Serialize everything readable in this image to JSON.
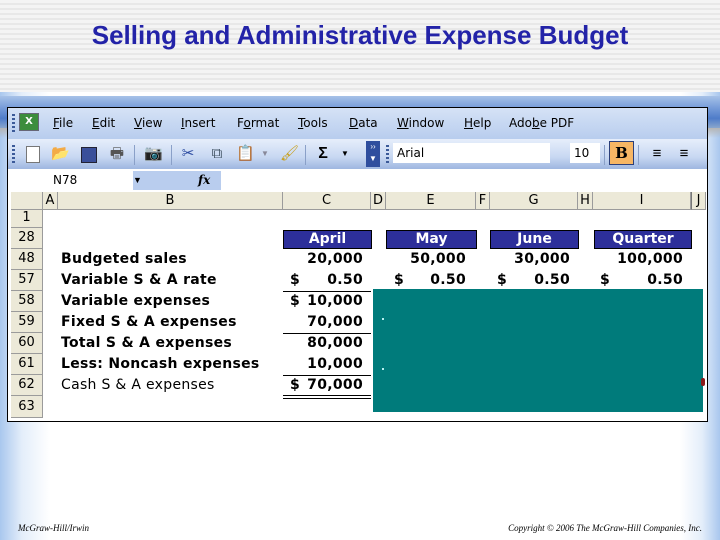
{
  "slide": {
    "title": "Selling and Administrative Expense Budget",
    "footer_left": "McGraw-Hill/Irwin",
    "footer_right": "Copyright © 2006 The McGraw-Hill Companies, Inc."
  },
  "excel": {
    "menu": [
      "File",
      "Edit",
      "View",
      "Insert",
      "Format",
      "Tools",
      "Data",
      "Window",
      "Help",
      "Adobe PDF"
    ],
    "menu_underline": [
      "F",
      "E",
      "V",
      "I",
      "o",
      "T",
      "D",
      "W",
      "H",
      "b"
    ],
    "toolbar_icons": [
      "new-icon",
      "open-icon",
      "save-icon",
      "print-preview-icon",
      "camera-icon",
      "cut-icon",
      "copy-icon",
      "paste-icon",
      "format-painter-icon",
      "autosum-icon"
    ],
    "font_name": "Arial",
    "font_size": "10",
    "bold_label": "B",
    "name_box": "N78",
    "fx_label": "fx",
    "columns": [
      "A",
      "B",
      "C",
      "D",
      "E",
      "F",
      "G",
      "H",
      "I",
      "J"
    ],
    "rows": [
      "1",
      "28",
      "48",
      "57",
      "58",
      "59",
      "60",
      "61",
      "62",
      "63"
    ],
    "headers": {
      "april": "April",
      "may": "May",
      "june": "June",
      "quarter": "Quarter"
    },
    "labels": {
      "r48": "Budgeted sales",
      "r57": "Variable S & A rate",
      "r58": "Variable expenses",
      "r59": "Fixed S & A expenses",
      "r60": "Total S & A expenses",
      "r61": "Less: Noncash expenses",
      "r62": "Cash S & A expenses"
    },
    "dollar": "$",
    "april": {
      "sales": "20,000",
      "rate": "0.50",
      "variable": "10,000",
      "fixed": "70,000",
      "total": "80,000",
      "noncash": "10,000",
      "cash": "70,000"
    },
    "may": {
      "sales": "50,000",
      "rate": "0.50"
    },
    "june": {
      "sales": "30,000",
      "rate": "0.50"
    },
    "quarter": {
      "sales": "100,000",
      "rate": "0.50"
    },
    "overlay_color": "#007b7b",
    "header_fill": "#2d2f9a"
  }
}
